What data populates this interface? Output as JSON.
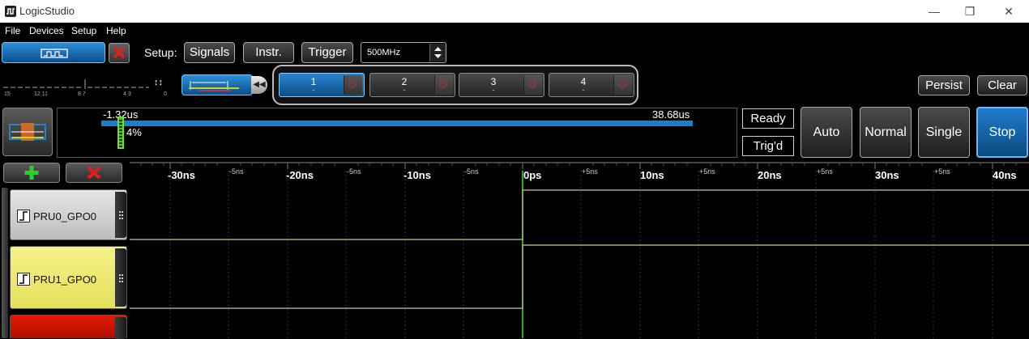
{
  "window": {
    "title": "LogicStudio",
    "minimize": "—",
    "restore": "❐",
    "close": "✕"
  },
  "menu": [
    "File",
    "Devices",
    "Setup",
    "Help"
  ],
  "toolbar": {
    "setup_label": "Setup:",
    "signals": "Signals",
    "instr": "Instr.",
    "trigger": "Trigger",
    "sample_rate": "500MHz"
  },
  "bitfield": {
    "labels": [
      "15",
      "12 11",
      "8 7",
      "4 3",
      "0"
    ]
  },
  "slots": [
    {
      "num": "1",
      "sub": "-"
    },
    {
      "num": "2",
      "sub": "-"
    },
    {
      "num": "3",
      "sub": "-"
    },
    {
      "num": "4",
      "sub": "-"
    }
  ],
  "overview": {
    "start": "-1.32us",
    "end": "38.68us",
    "percent": "4%"
  },
  "status": {
    "ready": "Ready",
    "trigd": "Trig'd"
  },
  "modes": {
    "auto": "Auto",
    "normal": "Normal",
    "single": "Single",
    "stop": "Stop"
  },
  "right_buttons": {
    "persist": "Persist",
    "clear": "Clear"
  },
  "axis": {
    "major": [
      "-30ns",
      "-20ns",
      "-10ns",
      "0ps",
      "10ns",
      "20ns",
      "30ns",
      "40ns"
    ],
    "minor": [
      "-5ns",
      "-5ns",
      "-5ns",
      "+5ns",
      "+5ns",
      "+5ns",
      "+5ns"
    ]
  },
  "channels": [
    {
      "name": "PRU0_GPO0",
      "color": "#d8d8d8"
    },
    {
      "name": "PRU1_GPO0",
      "color": "#f0ec7a"
    },
    {
      "name": "",
      "color": "#cc1100"
    }
  ],
  "colors": {
    "accent_blue": "#1a7fd0",
    "signal": "#c8c896",
    "trigger_line": "#3ce03c"
  }
}
